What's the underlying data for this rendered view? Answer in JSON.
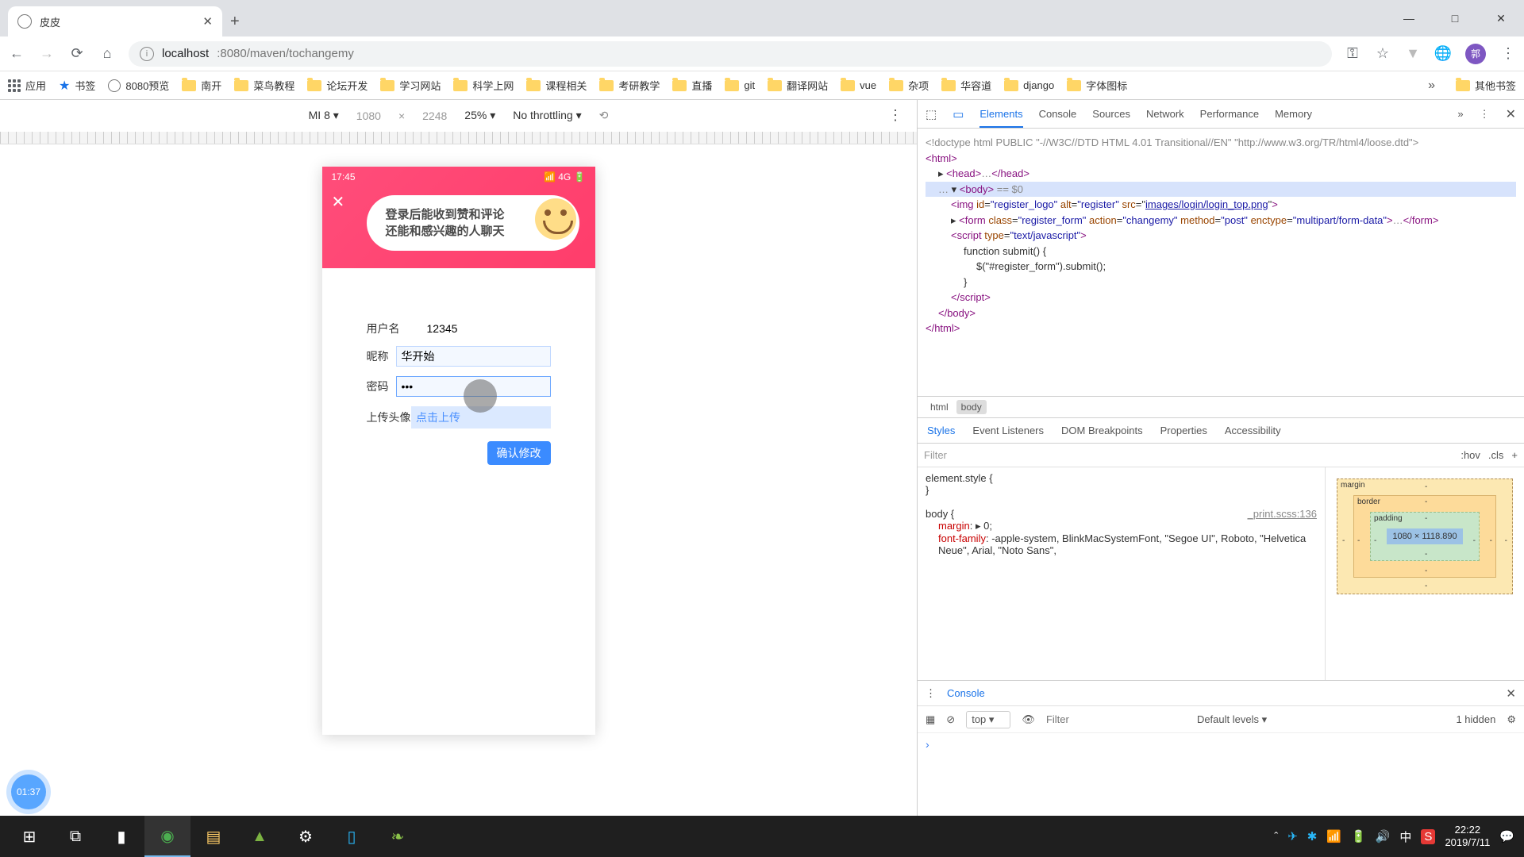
{
  "window": {
    "tab_title": "皮皮",
    "minimize": "—",
    "maximize": "□",
    "close": "✕",
    "newtab": "+"
  },
  "url": {
    "host": "localhost",
    "port_path": ":8080/maven/tochangemy"
  },
  "bookmarks": {
    "apps": "应用",
    "star": "书签",
    "prev8080": "8080预览",
    "items": [
      "南开",
      "菜鸟教程",
      "论坛开发",
      "学习网站",
      "科学上网",
      "课程相关",
      "考研教学",
      "直播",
      "git",
      "翻译网站",
      "vue",
      "杂项",
      "华容道",
      "django",
      "字体图标"
    ],
    "chev": "»",
    "other": "其他书签"
  },
  "device_toolbar": {
    "device": "MI 8 ▾",
    "w": "1080",
    "x": "×",
    "h": "2248",
    "zoom": "25% ▾",
    "throttle": "No throttling ▾",
    "more": "⋮"
  },
  "phone": {
    "status_time": "17:45",
    "status_right": "📶 4G 🔋",
    "close": "✕",
    "banner_l1": "登录后能收到赞和评论",
    "banner_l2": "还能和感兴趣的人聊天",
    "label_user": "用户名",
    "val_user": "12345",
    "label_nick": "昵称",
    "val_nick": "华开始",
    "label_pwd": "密码",
    "val_pwd": "•••",
    "label_upload": "上传头像",
    "val_upload": "点击上传",
    "submit": "确认修改"
  },
  "time_badge": "01:37",
  "devtools": {
    "tabs": [
      "Elements",
      "Console",
      "Sources",
      "Network",
      "Performance",
      "Memory"
    ],
    "active_tab": "Elements",
    "doctype": "<!doctype html PUBLIC \"-//W3C//DTD HTML 4.01 Transitional//EN\" \"http://www.w3.org/TR/html4/loose.dtd\">",
    "img_src": "images/login/login_top.png",
    "form_class": "register_form",
    "form_action": "changemy",
    "form_method": "post",
    "form_enctype": "multipart/form-data",
    "script_fn": "function submit() {",
    "script_body": "$(\"#register_form\").submit();",
    "selected": "== $0",
    "crumbs": [
      "html",
      "body"
    ],
    "style_tabs": [
      "Styles",
      "Event Listeners",
      "DOM Breakpoints",
      "Properties",
      "Accessibility"
    ],
    "filter_placeholder": "Filter",
    "hov": ":hov",
    "cls": ".cls",
    "plus": "+",
    "rule_el": "element.style {",
    "rule_body": "body {",
    "rule_src": "_print.scss:136",
    "rule_margin": "margin: ▸ 0;",
    "rule_ff": "font-family: -apple-system, BlinkMacSystemFont, \"Segoe UI\", Roboto, \"Helvetica Neue\", Arial, \"Noto Sans\",",
    "box_content": "1080 × 1118.890",
    "box_margin": "margin",
    "box_border": "border",
    "box_padding": "padding",
    "console_title": "Console",
    "console_top": "top",
    "console_filter": "Filter",
    "console_levels": "Default levels ▾",
    "console_hidden": "1 hidden",
    "console_prompt": "›"
  },
  "taskbar": {
    "tray": {
      "time": "22:22",
      "date": "2019/7/11",
      "ime1": "中",
      "ime2": "S"
    }
  }
}
